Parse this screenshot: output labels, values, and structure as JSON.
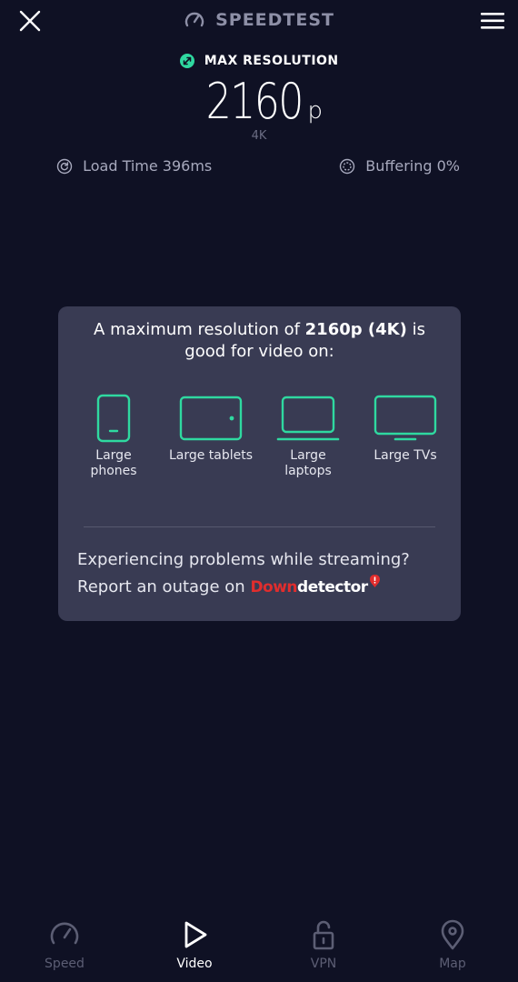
{
  "header": {
    "brand": "SPEEDTEST",
    "close_icon": "close-icon",
    "menu_icon": "hamburger-menu-icon"
  },
  "result": {
    "label": "MAX RESOLUTION",
    "value": "2160",
    "unit": "p",
    "sub": "4K"
  },
  "metrics": {
    "load_time": "Load Time 396ms",
    "buffering": "Buffering 0%"
  },
  "card": {
    "head_prefix": "A maximum resolution of ",
    "head_bold": "2160p (4K)",
    "head_suffix_line1": " is",
    "head_line2": "good for video on:",
    "devices": [
      {
        "line1": "Large",
        "line2": "phones"
      },
      {
        "line1": "Large tablets",
        "line2": ""
      },
      {
        "line1": "Large",
        "line2": "laptops"
      },
      {
        "line1": "Large TVs",
        "line2": ""
      }
    ],
    "problem_text": "Experiencing problems while streaming?",
    "report_text": "Report an outage on ",
    "brand_down": "Down",
    "brand_detector": "detector"
  },
  "nav": {
    "items": [
      {
        "label": "Speed"
      },
      {
        "label": "Video"
      },
      {
        "label": "VPN"
      },
      {
        "label": "Map"
      }
    ],
    "active": "Video"
  },
  "colors": {
    "background": "#0f1124",
    "card": "#393b53",
    "accent_green": "#2fd9a0",
    "downdetector_red": "#e12d2d",
    "muted": "#8d8fa6"
  }
}
